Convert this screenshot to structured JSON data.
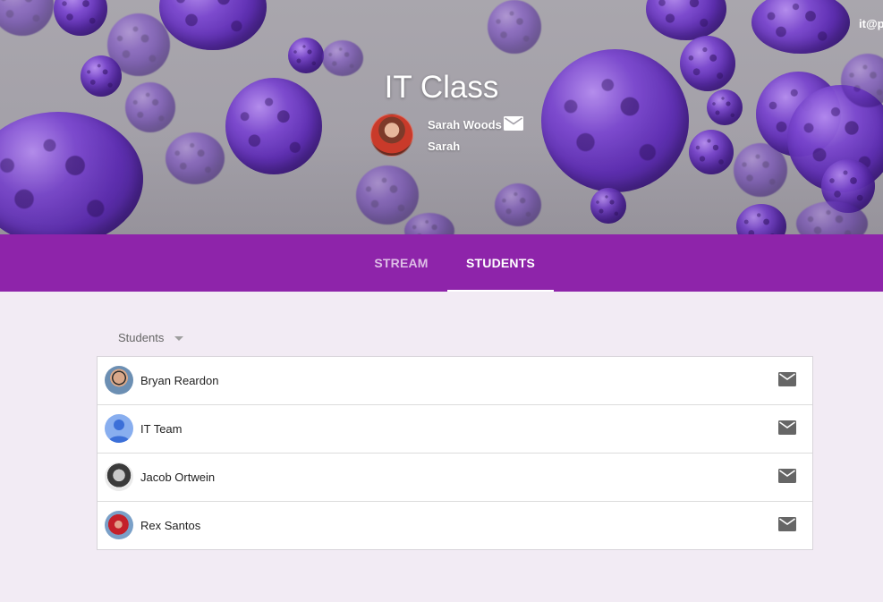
{
  "header": {
    "class_title": "IT Class",
    "teacher_name": "Sarah Woods",
    "teacher_subtitle": "Sarah",
    "account_label": "it@p"
  },
  "tabs": [
    {
      "label": "STREAM",
      "active": false
    },
    {
      "label": "STUDENTS",
      "active": true
    }
  ],
  "filter": {
    "label": "Students"
  },
  "students": [
    {
      "name": "Bryan Reardon",
      "avatar": "photo"
    },
    {
      "name": "IT Team",
      "avatar": "default-person-icon"
    },
    {
      "name": "Jacob Ortwein",
      "avatar": "photo"
    },
    {
      "name": "Rex Santos",
      "avatar": "photo"
    }
  ],
  "colors": {
    "tab_bar": "#8e24aa",
    "page_background": "#f2ebf4",
    "mail_icon": "#666666",
    "default_avatar": "#88aeef"
  },
  "icons": {
    "mail": "mail-icon",
    "dropdown": "chevron-down-icon",
    "default_avatar": "person-icon"
  }
}
